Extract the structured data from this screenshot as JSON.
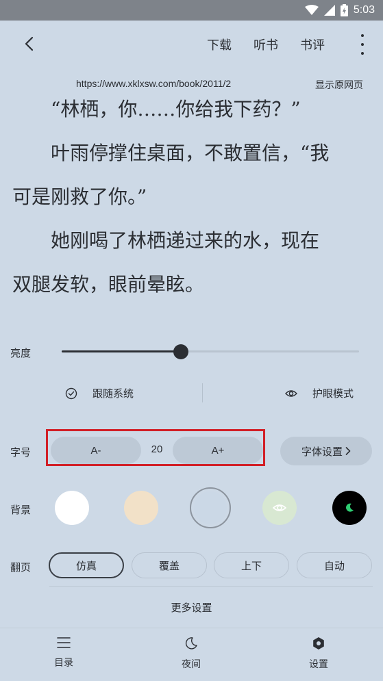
{
  "status_bar": {
    "time": "5:03"
  },
  "toolbar": {
    "download": "下载",
    "listen": "听书",
    "reviews": "书评"
  },
  "reader": {
    "url": "https://www.xklxsw.com/book/2011/2",
    "show_original": "显示原网页",
    "paragraphs": [
      "“林栖，你……你给我下药？”",
      "叶雨停撑住桌面，不敢置信，“我",
      "可是刚救了你。”",
      "她刚喝了林栖递过来的水，现在",
      "双腿发软，眼前晕眩。"
    ]
  },
  "settings": {
    "brightness_label": "亮度",
    "brightness_value": 0.4,
    "follow_system": "跟随系统",
    "eye_mode": "护眼模式",
    "font_size_label": "字号",
    "decrease": "A-",
    "font_size": "20",
    "increase": "A+",
    "font_settings": "字体设置",
    "background_label": "背景",
    "backgrounds": [
      {
        "name": "white",
        "color": "#ffffff"
      },
      {
        "name": "beige",
        "color": "#f2e1c8"
      },
      {
        "name": "blue-gray",
        "color": "#cdd9e6",
        "selected": true
      },
      {
        "name": "eye-green",
        "color": "#d8e8d2"
      },
      {
        "name": "night",
        "color": "#000000"
      }
    ],
    "page_turn_label": "翻页",
    "page_turn_options": [
      "仿真",
      "覆盖",
      "上下",
      "自动"
    ],
    "page_turn_selected": "仿真",
    "more_settings": "更多设置"
  },
  "bottom_nav": {
    "contents": "目录",
    "night": "夜间",
    "settings": "设置"
  }
}
